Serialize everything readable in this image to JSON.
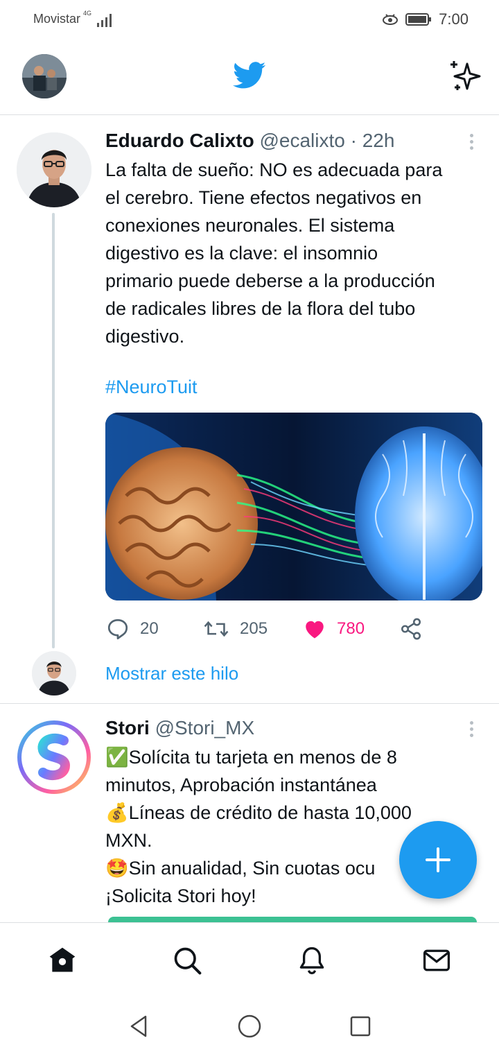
{
  "status_bar": {
    "carrier": "Movistar",
    "network": "4G",
    "time": "7:00"
  },
  "header": {
    "logo": "twitter-bird-icon",
    "accent_color": "#1d9bf0"
  },
  "tweets": [
    {
      "author_name": "Eduardo Calixto",
      "handle_time": "@ecalixto · 22h",
      "text": "La falta de sueño: NO es adecuada para\nel cerebro. Tiene efectos negativos en\nconexiones neuronales. El sistema\ndigestivo es la clave: el insomnio\nprimario puede deberse a la producción\nde radicales libres de la flora del tubo\ndigestivo.",
      "hashtag": "#NeuroTuit",
      "replies": "20",
      "retweets": "205",
      "likes": "780",
      "liked": true,
      "show_thread": "Mostrar este hilo"
    },
    {
      "author_name": "Stori",
      "handle": "@Stori_MX",
      "text": "✅Solícita tu tarjeta en menos de 8\nminutos, Aprobación instantánea\n💰Líneas de crédito de hasta 10,000\nMXN.\n🤩Sin anualidad, Sin cuotas ocu\n¡Solicita Stori hoy!"
    }
  ],
  "nav": [
    "home-icon",
    "search-icon",
    "notifications-icon",
    "messages-icon"
  ]
}
